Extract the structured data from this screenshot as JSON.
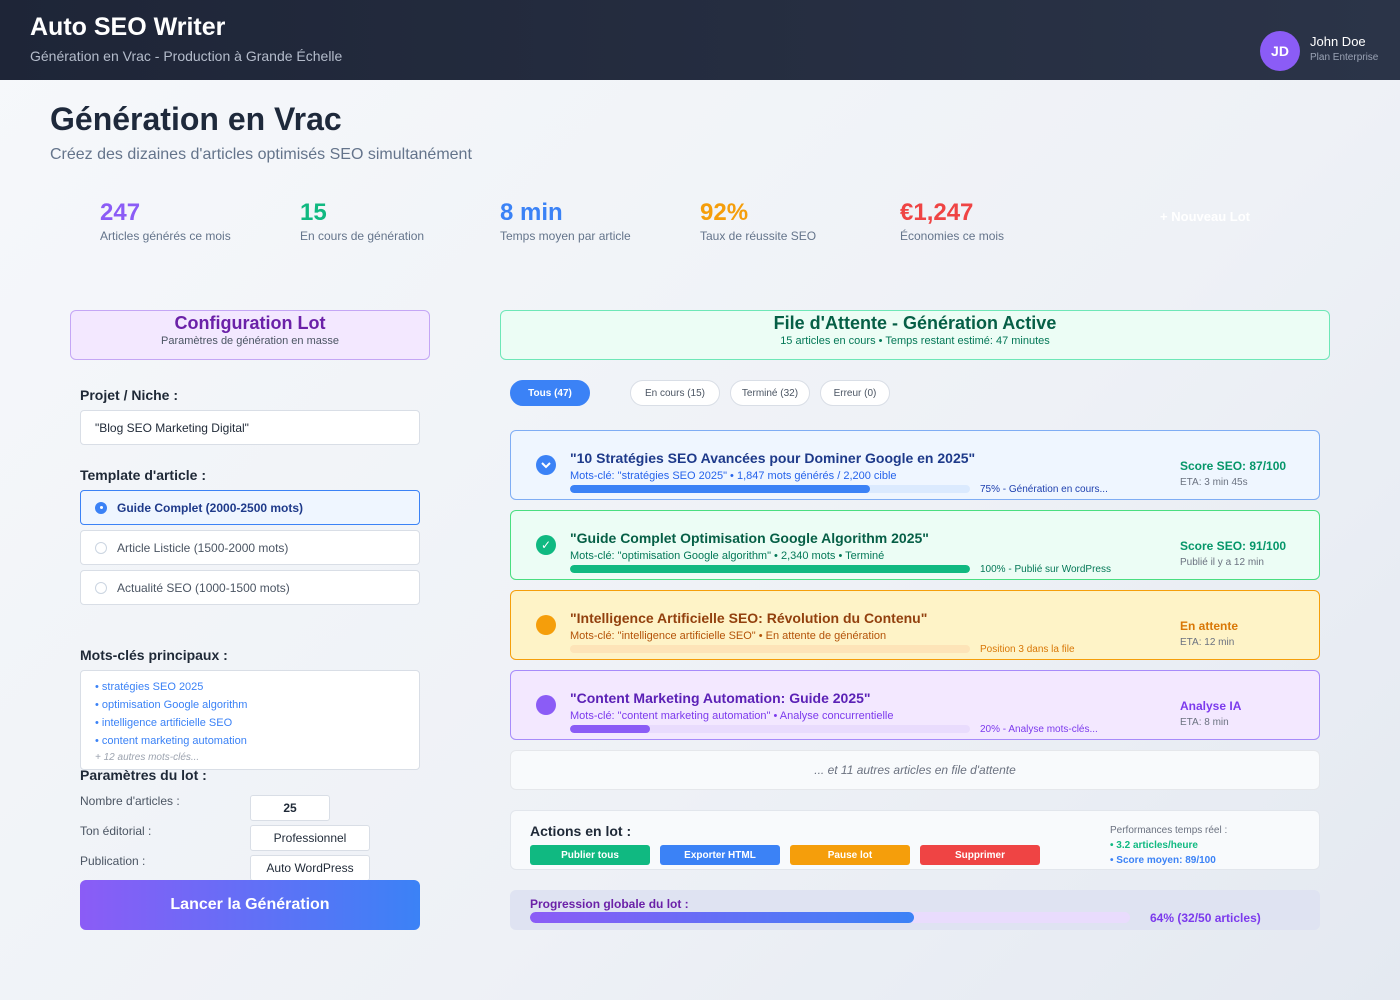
{
  "header": {
    "app_title": "Auto SEO Writer",
    "app_subtitle": "Génération en Vrac - Production à Grande Échelle",
    "user": {
      "initials": "JD",
      "name": "John Doe",
      "plan": "Plan Enterprise"
    }
  },
  "page": {
    "title": "Génération en Vrac",
    "subtitle": "Créez des dizaines d'articles optimisés SEO simultanément"
  },
  "stats": [
    {
      "value": "247",
      "label": "Articles générés ce mois",
      "color": "#8b5cf6"
    },
    {
      "value": "15",
      "label": "En cours de génération",
      "color": "#10b981"
    },
    {
      "value": "8 min",
      "label": "Temps moyen par article",
      "color": "#3b82f6"
    },
    {
      "value": "92%",
      "label": "Taux de réussite SEO",
      "color": "#f59e0b"
    },
    {
      "value": "€1,247",
      "label": "Économies ce mois",
      "color": "#ef4444"
    }
  ],
  "new_lot_label": "+ Nouveau Lot",
  "config": {
    "title": "Configuration Lot",
    "subtitle": "Paramètres de génération en masse",
    "project_label": "Projet / Niche :",
    "project_value": "\"Blog SEO Marketing Digital\"",
    "template_label": "Template d'article :",
    "templates": [
      {
        "label": "Guide Complet (2000-2500 mots)",
        "selected": true
      },
      {
        "label": "Article Listicle (1500-2000 mots)",
        "selected": false
      },
      {
        "label": "Actualité SEO (1000-1500 mots)",
        "selected": false
      }
    ],
    "keywords_label": "Mots-clés principaux :",
    "keywords": [
      "• stratégies SEO 2025",
      "• optimisation Google algorithm",
      "• intelligence artificielle SEO",
      "• content marketing automation"
    ],
    "keywords_more": "+ 12 autres mots-clés...",
    "params_label": "Paramètres du lot :",
    "params": [
      {
        "label": "Nombre d'articles :",
        "value": "25"
      },
      {
        "label": "Ton éditorial :",
        "value": "Professionnel"
      },
      {
        "label": "Publication :",
        "value": "Auto WordPress"
      }
    ],
    "launch_label": "Lancer la Génération"
  },
  "queue": {
    "title": "File d'Attente - Génération Active",
    "subtitle": "15 articles en cours • Temps restant estimé: 47 minutes",
    "tabs": [
      "Tous (47)",
      "En cours (15)",
      "Terminé (32)",
      "Erreur (0)"
    ],
    "active_tab": 0,
    "items": [
      {
        "icon": "chevron-down-icon",
        "title": "\"10 Stratégies SEO Avancées pour Dominer Google en 2025\"",
        "meta": "Mots-clé: \"stratégies SEO 2025\" • 1,847 mots générés / 2,200 cible",
        "progress": 0.75,
        "progress_text": "75% - Génération en cours...",
        "score": "Score SEO: 87/100",
        "eta": "ETA: 3 min 45s"
      },
      {
        "icon": "checkmark-icon",
        "title": "\"Guide Complet Optimisation Google Algorithm 2025\"",
        "meta": "Mots-clé: \"optimisation Google algorithm\" • 2,340 mots • Terminé",
        "progress": 1.0,
        "progress_text": "100% - Publié sur WordPress",
        "score": "Score SEO: 91/100",
        "eta": "Publié il y a 12 min"
      },
      {
        "icon": "circle-icon",
        "title": "\"Intelligence Artificielle SEO: Révolution du Contenu\"",
        "meta": "Mots-clé: \"intelligence artificielle SEO\" • En attente de génération",
        "progress": 0.0,
        "progress_text": "Position 3 dans la file",
        "score": "En attente",
        "eta": "ETA: 12 min"
      },
      {
        "icon": "circle-icon",
        "title": "\"Content Marketing Automation: Guide 2025\"",
        "meta": "Mots-clé: \"content marketing automation\" • Analyse concurrentielle",
        "progress": 0.2,
        "progress_text": "20% - Analyse mots-clés...",
        "score": "Analyse IA",
        "eta": "ETA: 8 min"
      }
    ],
    "more_text": "... et 11 autres articles en file d'attente"
  },
  "actions": {
    "title": "Actions en lot :",
    "buttons": [
      {
        "label": "Publier tous",
        "color": "#10b981"
      },
      {
        "label": "Exporter HTML",
        "color": "#3b82f6"
      },
      {
        "label": "Pause lot",
        "color": "#f59e0b"
      },
      {
        "label": "Supprimer",
        "color": "#ef4444"
      }
    ],
    "perf_title": "Performances temps réel :",
    "perf_rate": "• 3.2 articles/heure",
    "perf_score": "• Score moyen: 89/100"
  },
  "global_progress": {
    "label": "Progression globale du lot :",
    "fraction": 0.64,
    "text": "64% (32/50 articles)"
  }
}
